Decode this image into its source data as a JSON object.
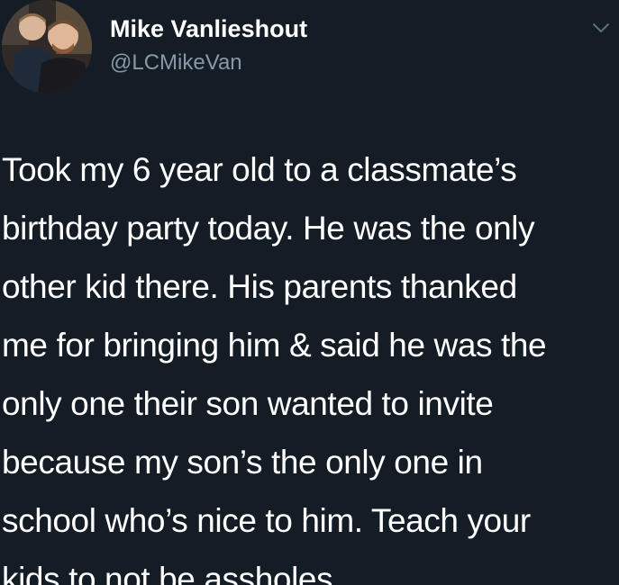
{
  "tweet": {
    "author_name": "Mike Vanlieshout",
    "author_handle": "@LCMikeVan",
    "text_lines": [
      "Took my 6 year old to a classmate’s",
      "birthday party today. He was the only",
      "other kid there. His parents thanked",
      "me for bringing him & said he was the",
      "only one their son wanted to invite",
      "because my son’s the only one in",
      "school who’s nice to him. Teach your",
      "kids to not be assholes."
    ]
  },
  "icons": {
    "avatar": "profile-photo",
    "menu": "chevron-down-icon"
  },
  "colors": {
    "background": "#141c26",
    "text": "#ffffff",
    "secondary_text": "#8899a6"
  }
}
